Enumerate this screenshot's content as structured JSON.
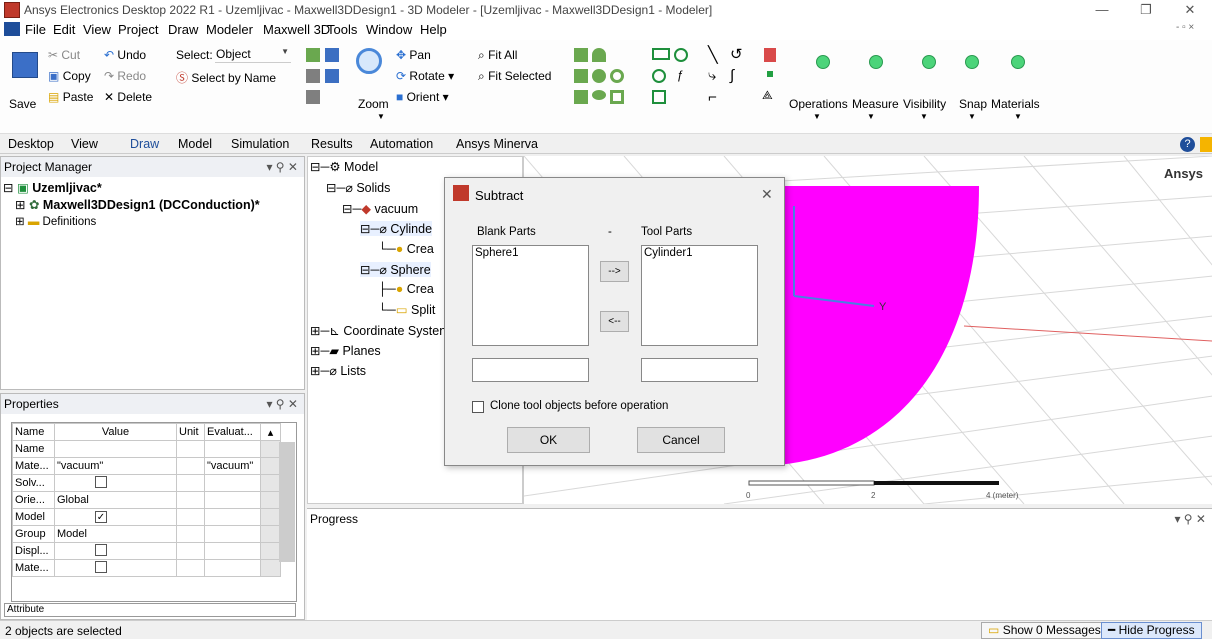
{
  "window": {
    "title": "Ansys Electronics Desktop 2022 R1 - Uzemljivac - Maxwell3DDesign1 - 3D Modeler - [Uzemljivac - Maxwell3DDesign1 - Modeler]",
    "minimize": "—",
    "restore": "❐",
    "close": "✕",
    "mdi_controls": "- ▫ ×"
  },
  "menu": [
    "File",
    "Edit",
    "View",
    "Project",
    "Draw",
    "Modeler",
    "Maxwell 3D",
    "Tools",
    "Window",
    "Help"
  ],
  "ribbon": {
    "save": "Save",
    "cut": "Cut",
    "copy": "Copy",
    "paste": "Paste",
    "undo": "Undo",
    "redo": "Redo",
    "delete": "Delete",
    "select_label": "Select:",
    "select_value": "Object",
    "select_by_name": "Select by Name",
    "zoom": "Zoom",
    "pan": "Pan",
    "rotate": "Rotate",
    "orient": "Orient",
    "fit_all": "Fit All",
    "fit_selected": "Fit Selected",
    "groups": [
      "Operations",
      "Measure",
      "Visibility",
      "Snap",
      "Materials"
    ]
  },
  "ribbon_tabs": [
    "Desktop",
    "View",
    "Draw",
    "Model",
    "Simulation",
    "Results",
    "Automation",
    "Ansys Minerva"
  ],
  "active_tab": "Draw",
  "project_manager": {
    "title": "Project Manager",
    "project": "Uzemljivac*",
    "design": "Maxwell3DDesign1 (DCConduction)*",
    "definitions": "Definitions"
  },
  "properties": {
    "title": "Properties",
    "headers": [
      "Name",
      "Value",
      "Unit",
      "Evaluat..."
    ],
    "rows": [
      {
        "name": "Name",
        "value": "",
        "eval": "",
        "check": null
      },
      {
        "name": "Mate...",
        "value": "\"vacuum\"",
        "eval": "\"vacuum\"",
        "check": null
      },
      {
        "name": "Solv...",
        "value": "",
        "eval": "",
        "check": false
      },
      {
        "name": "Orie...",
        "value": "Global",
        "eval": "",
        "check": null
      },
      {
        "name": "Model",
        "value": "",
        "eval": "",
        "check": true
      },
      {
        "name": "Group",
        "value": "Model",
        "eval": "",
        "check": null
      },
      {
        "name": "Displ...",
        "value": "",
        "eval": "",
        "check": false
      },
      {
        "name": "Mate...",
        "value": "",
        "eval": "",
        "check": false
      }
    ],
    "tab": "Attribute"
  },
  "tree": {
    "model": "Model",
    "solids": "Solids",
    "vacuum": "vacuum",
    "cylinder": "Cylinde",
    "create1": "Crea",
    "sphere": "Sphere",
    "create2": "Crea",
    "split": "Split",
    "coordinate_systems": "Coordinate Systen",
    "planes": "Planes",
    "lists": "Lists"
  },
  "viewport": {
    "brand": "Ansys",
    "axis_y": "Y",
    "scale_ticks": [
      "0",
      "2",
      "4 (meter)"
    ],
    "shape_color": "#ff00ff"
  },
  "dialog": {
    "title": "Subtract",
    "close": "✕",
    "blank_label": "Blank Parts",
    "minus": "-",
    "tool_label": "Tool Parts",
    "blank_items": [
      "Sphere1"
    ],
    "tool_items": [
      "Cylinder1"
    ],
    "move_right": "-->",
    "move_left": "<--",
    "clone_label": "Clone tool objects before operation",
    "ok": "OK",
    "cancel": "Cancel"
  },
  "progress": {
    "title": "Progress"
  },
  "status": {
    "text": "2 objects are selected",
    "show_messages": "Show 0 Messages",
    "hide_progress": "Hide Progress"
  },
  "colors": {
    "accent": "#1f4e9a",
    "shape": "#ff00ff",
    "green_button": "#4cd47a"
  }
}
